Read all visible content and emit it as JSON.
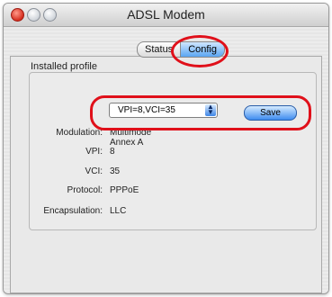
{
  "window": {
    "title": "ADSL Modem"
  },
  "tabs": [
    {
      "label": "Status",
      "selected": false
    },
    {
      "label": "Config",
      "selected": true
    }
  ],
  "group": {
    "title": "Installed profile"
  },
  "profile_select": {
    "value": "VPI=8,VCI=35"
  },
  "save_button": {
    "label": "Save"
  },
  "fields": [
    {
      "label": "Modulation:",
      "value": "Multimode Annex A"
    },
    {
      "label": "VPI:",
      "value": "8"
    },
    {
      "label": "VCI:",
      "value": "35"
    },
    {
      "label": "Protocol:",
      "value": "PPPoE"
    },
    {
      "label": "Encapsulation:",
      "value": "LLC"
    }
  ],
  "colors": {
    "highlight": "#e0101a",
    "tab_selected": "#5aa6f2"
  }
}
